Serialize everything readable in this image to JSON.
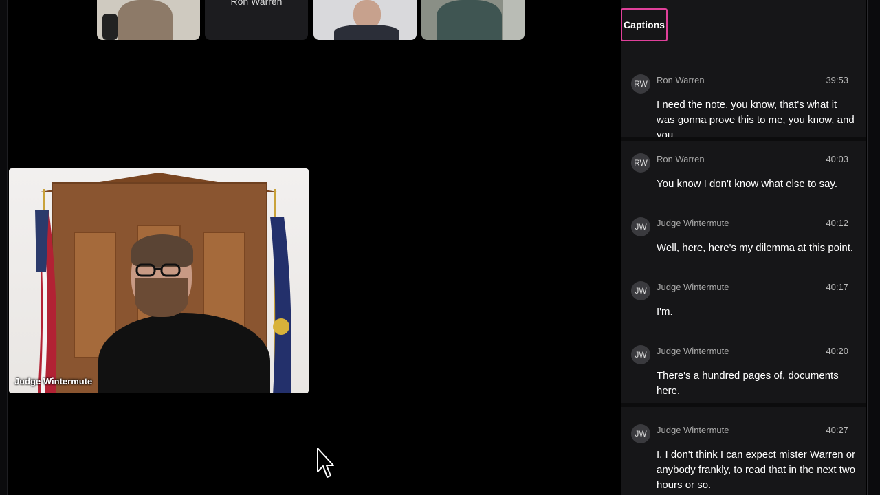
{
  "participants_top": [
    {
      "name": ""
    },
    {
      "name": "Ron Warren"
    },
    {
      "name": ""
    },
    {
      "name": ""
    }
  ],
  "main_video": {
    "label": "Judge Wintermute"
  },
  "captions": {
    "button_label": "Captions",
    "entries": [
      {
        "initials": "RW",
        "speaker": "Ron Warren",
        "time": "39:53",
        "text": "I need the note, you know, that's what it was gonna prove this to me, you know, and you."
      },
      {
        "initials": "RW",
        "speaker": "Ron Warren",
        "time": "40:03",
        "text": "You know I don't know what else to say."
      },
      {
        "initials": "JW",
        "speaker": "Judge Wintermute",
        "time": "40:12",
        "text": "Well, here, here's my dilemma at this point."
      },
      {
        "initials": "JW",
        "speaker": "Judge Wintermute",
        "time": "40:17",
        "text": "I'm."
      },
      {
        "initials": "JW",
        "speaker": "Judge Wintermute",
        "time": "40:20",
        "text": "There's a hundred pages of, documents here."
      },
      {
        "initials": "JW",
        "speaker": "Judge Wintermute",
        "time": "40:27",
        "text": "I, I don't think I can expect mister Warren or anybody frankly, to read that in the next two hours or so."
      }
    ]
  },
  "colors": {
    "captions_highlight": "#e0409a",
    "panel_bg": "#161618"
  }
}
